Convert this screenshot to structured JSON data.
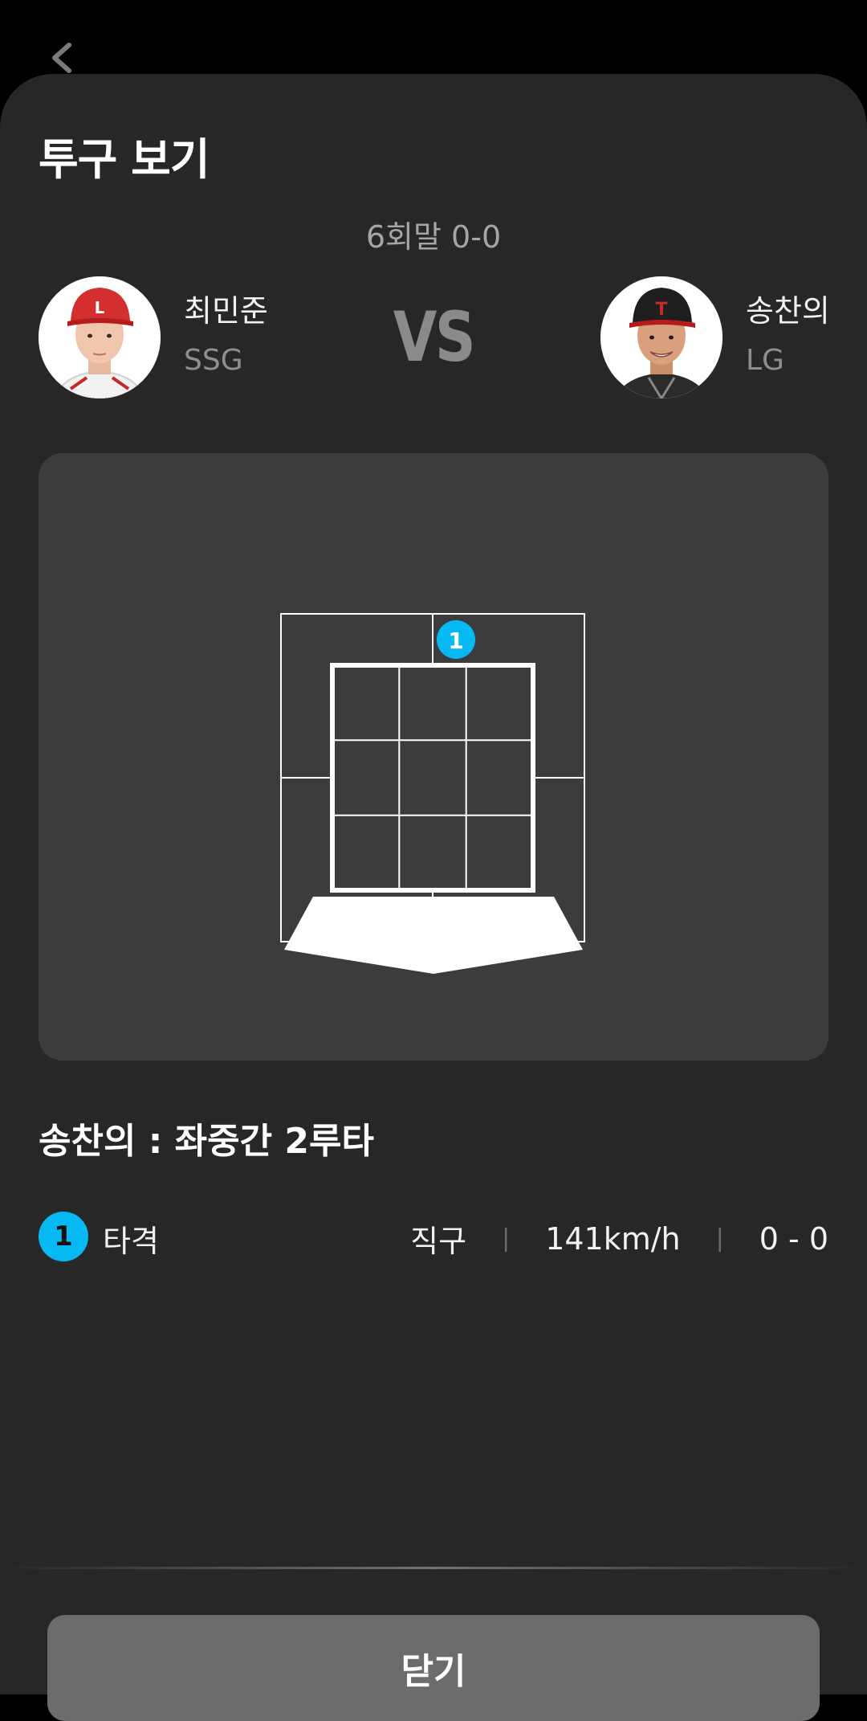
{
  "header": {
    "title": "투구 보기",
    "inning_score": "6회말 0-0"
  },
  "matchup": {
    "pitcher": {
      "name": "최민준",
      "team": "SSG"
    },
    "vs_label": "VS",
    "batter": {
      "name": "송찬의",
      "team": "LG"
    }
  },
  "strike_zone": {
    "pitches": [
      {
        "number": "1",
        "zone_row": 1,
        "zone_col": 2
      }
    ]
  },
  "result_text": "송찬의 : 좌중간 2루타",
  "pitch_log": [
    {
      "number": "1",
      "result": "타격",
      "pitch_type": "직구",
      "speed": "141km/h",
      "count": "0 - 0"
    }
  ],
  "separator": "|",
  "close_label": "닫기",
  "colors": {
    "pitch_badge": "#06b9f2",
    "sheet_bg": "#272727",
    "panel_bg": "#3c3c3c",
    "close_button": "#6c6c6c"
  }
}
